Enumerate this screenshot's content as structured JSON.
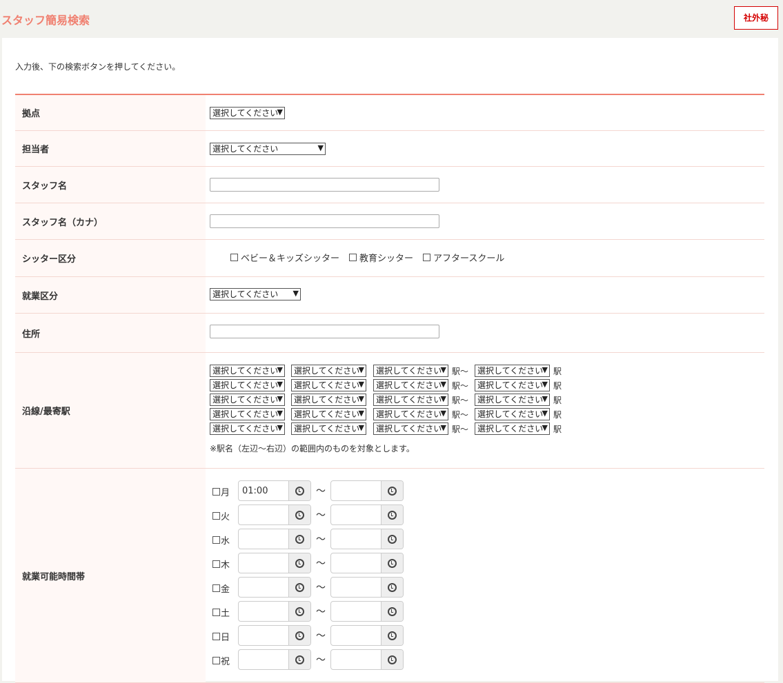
{
  "header": {
    "title": "スタッフ簡易検索",
    "badge": "社外秘"
  },
  "instruction": "入力後、下の検索ボタンを押してください。",
  "fields": {
    "base": {
      "label": "拠点",
      "value": "選択してください"
    },
    "manager": {
      "label": "担当者",
      "value": "選択してください"
    },
    "staff_name": {
      "label": "スタッフ名",
      "value": ""
    },
    "staff_kana": {
      "label": "スタッフ名（カナ）",
      "value": ""
    },
    "sitter_type": {
      "label": "シッター区分",
      "options": [
        "ベビー＆キッズシッター",
        "教育シッター",
        "アフタースクール"
      ]
    },
    "employment": {
      "label": "就業区分",
      "value": "選択してください"
    },
    "address": {
      "label": "住所",
      "value": ""
    },
    "station": {
      "label": "沿線/最寄駅",
      "select_value": "選択してください",
      "from_suffix": "駅～",
      "to_suffix": "駅",
      "rows": 5,
      "note": "※駅名（左辺～右辺）の範囲内のものを対象とします。"
    },
    "hours": {
      "label": "就業可能時間帯",
      "tilde": "～",
      "days": [
        {
          "day": "月",
          "from": "01:00",
          "to": ""
        },
        {
          "day": "火",
          "from": "",
          "to": ""
        },
        {
          "day": "水",
          "from": "",
          "to": ""
        },
        {
          "day": "木",
          "from": "",
          "to": ""
        },
        {
          "day": "金",
          "from": "",
          "to": ""
        },
        {
          "day": "土",
          "from": "",
          "to": ""
        },
        {
          "day": "日",
          "from": "",
          "to": ""
        },
        {
          "day": "祝",
          "from": "",
          "to": ""
        }
      ]
    }
  },
  "icons": {
    "dropdown": "chevron-down-icon",
    "time": "clock-icon",
    "checkbox": "checkbox-icon"
  },
  "colors": {
    "accent": "#f08070",
    "badge": "#d40000",
    "label_bg": "#fff8f6"
  }
}
